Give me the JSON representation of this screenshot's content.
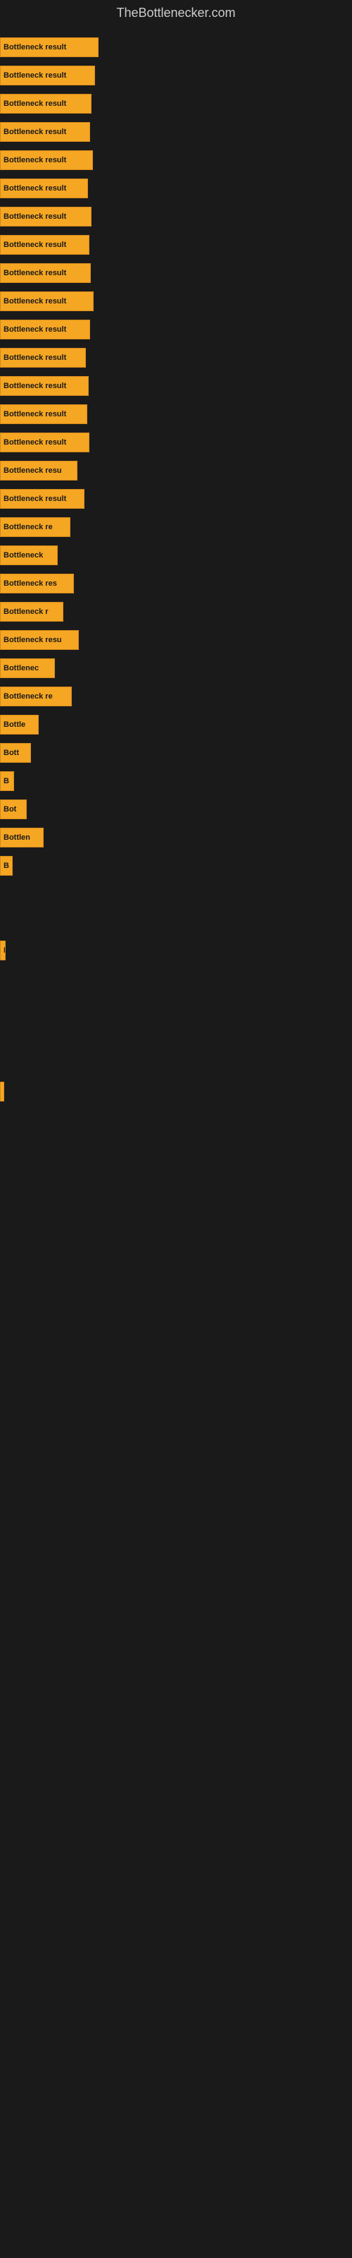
{
  "site": {
    "title": "TheBottlenecker.com"
  },
  "bars": [
    {
      "label": "Bottleneck result",
      "width": 140
    },
    {
      "label": "Bottleneck result",
      "width": 135
    },
    {
      "label": "Bottleneck result",
      "width": 130
    },
    {
      "label": "Bottleneck result",
      "width": 128
    },
    {
      "label": "Bottleneck result",
      "width": 132
    },
    {
      "label": "Bottleneck result",
      "width": 125
    },
    {
      "label": "Bottleneck result",
      "width": 130
    },
    {
      "label": "Bottleneck result",
      "width": 127
    },
    {
      "label": "Bottleneck result",
      "width": 129
    },
    {
      "label": "Bottleneck result",
      "width": 133
    },
    {
      "label": "Bottleneck result",
      "width": 128
    },
    {
      "label": "Bottleneck result",
      "width": 122
    },
    {
      "label": "Bottleneck result",
      "width": 126
    },
    {
      "label": "Bottleneck result",
      "width": 124
    },
    {
      "label": "Bottleneck result",
      "width": 127
    },
    {
      "label": "Bottleneck resu",
      "width": 110
    },
    {
      "label": "Bottleneck result",
      "width": 120
    },
    {
      "label": "Bottleneck re",
      "width": 100
    },
    {
      "label": "Bottleneck",
      "width": 82
    },
    {
      "label": "Bottleneck res",
      "width": 105
    },
    {
      "label": "Bottleneck r",
      "width": 90
    },
    {
      "label": "Bottleneck resu",
      "width": 112
    },
    {
      "label": "Bottlenec",
      "width": 78
    },
    {
      "label": "Bottleneck re",
      "width": 102
    },
    {
      "label": "Bottle",
      "width": 55
    },
    {
      "label": "Bott",
      "width": 44
    },
    {
      "label": "B",
      "width": 20
    },
    {
      "label": "Bot",
      "width": 38
    },
    {
      "label": "Bottlen",
      "width": 62
    },
    {
      "label": "B",
      "width": 18
    },
    {
      "label": "",
      "width": 0
    },
    {
      "label": "",
      "width": 0
    },
    {
      "label": "I",
      "width": 8
    },
    {
      "label": "",
      "width": 0
    },
    {
      "label": "",
      "width": 0
    },
    {
      "label": "",
      "width": 0
    },
    {
      "label": "",
      "width": 0
    },
    {
      "label": "",
      "width": 4
    }
  ]
}
